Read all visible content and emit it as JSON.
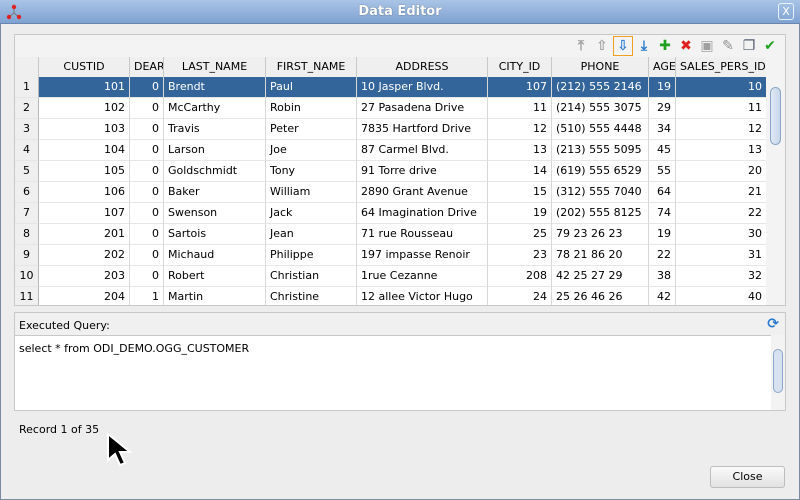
{
  "window": {
    "title": "Data Editor",
    "close_label": "X"
  },
  "toolbar": {
    "buttons": [
      {
        "name": "first-record-button",
        "glyph": "⤒",
        "color": "#a0a0a0"
      },
      {
        "name": "previous-record-button",
        "glyph": "⇧",
        "color": "#a0a0a0"
      },
      {
        "name": "next-record-button",
        "glyph": "⇩",
        "color": "#2a7ad0",
        "selected": true
      },
      {
        "name": "last-record-button",
        "glyph": "⤓",
        "color": "#2a7ad0"
      },
      {
        "name": "insert-row-button",
        "glyph": "✚",
        "color": "#20a020"
      },
      {
        "name": "delete-row-button",
        "glyph": "✖",
        "color": "#e02020"
      },
      {
        "name": "save-button",
        "glyph": "▣",
        "color": "#a0a0a0"
      },
      {
        "name": "clear-button",
        "glyph": "✎",
        "color": "#909090"
      },
      {
        "name": "copy-button",
        "glyph": "❐",
        "color": "#505a70"
      },
      {
        "name": "commit-button",
        "glyph": "✔",
        "color": "#20a020"
      }
    ]
  },
  "table": {
    "columns": [
      "CUSTID",
      "DEAR",
      "LAST_NAME",
      "FIRST_NAME",
      "ADDRESS",
      "CITY_ID",
      "PHONE",
      "AGE",
      "SALES_PERS_ID"
    ],
    "rows": [
      [
        "1",
        "101",
        "0",
        "Brendt",
        "Paul",
        "10 Jasper Blvd.",
        "107",
        "(212) 555 2146",
        "19",
        "10"
      ],
      [
        "2",
        "102",
        "0",
        "McCarthy",
        "Robin",
        "27 Pasadena Drive",
        "11",
        "(214) 555 3075",
        "29",
        "11"
      ],
      [
        "3",
        "103",
        "0",
        "Travis",
        "Peter",
        "7835 Hartford Drive",
        "12",
        "(510) 555 4448",
        "34",
        "12"
      ],
      [
        "4",
        "104",
        "0",
        "Larson",
        "Joe",
        "87 Carmel Blvd.",
        "13",
        "(213) 555 5095",
        "45",
        "13"
      ],
      [
        "5",
        "105",
        "0",
        "Goldschmidt",
        "Tony",
        "91 Torre drive",
        "14",
        "(619) 555 6529",
        "55",
        "20"
      ],
      [
        "6",
        "106",
        "0",
        "Baker",
        "William",
        "2890 Grant Avenue",
        "15",
        "(312) 555 7040",
        "64",
        "21"
      ],
      [
        "7",
        "107",
        "0",
        "Swenson",
        "Jack",
        "64 Imagination Drive",
        "19",
        "(202) 555 8125",
        "74",
        "22"
      ],
      [
        "8",
        "201",
        "0",
        "Sartois",
        "Jean",
        "71 rue Rousseau",
        "25",
        "79 23 26 23",
        "19",
        "30"
      ],
      [
        "9",
        "202",
        "0",
        "Michaud",
        "Philippe",
        "197 impasse Renoir",
        "23",
        "78 21 86 20",
        "22",
        "31"
      ],
      [
        "10",
        "203",
        "0",
        "Robert",
        "Christian",
        "1rue Cezanne",
        "208",
        "42 25 27 29",
        "38",
        "32"
      ],
      [
        "11",
        "204",
        "1",
        "Martin",
        "Christine",
        "12 allee Victor Hugo",
        "24",
        "25 26 46 26",
        "42",
        "40"
      ]
    ],
    "selected_row": 1
  },
  "query": {
    "label": "Executed Query:",
    "text": "select * from ODI_DEMO.OGG_CUSTOMER"
  },
  "status": {
    "record": "Record 1 of 35"
  },
  "footer": {
    "close_label": "Close"
  }
}
